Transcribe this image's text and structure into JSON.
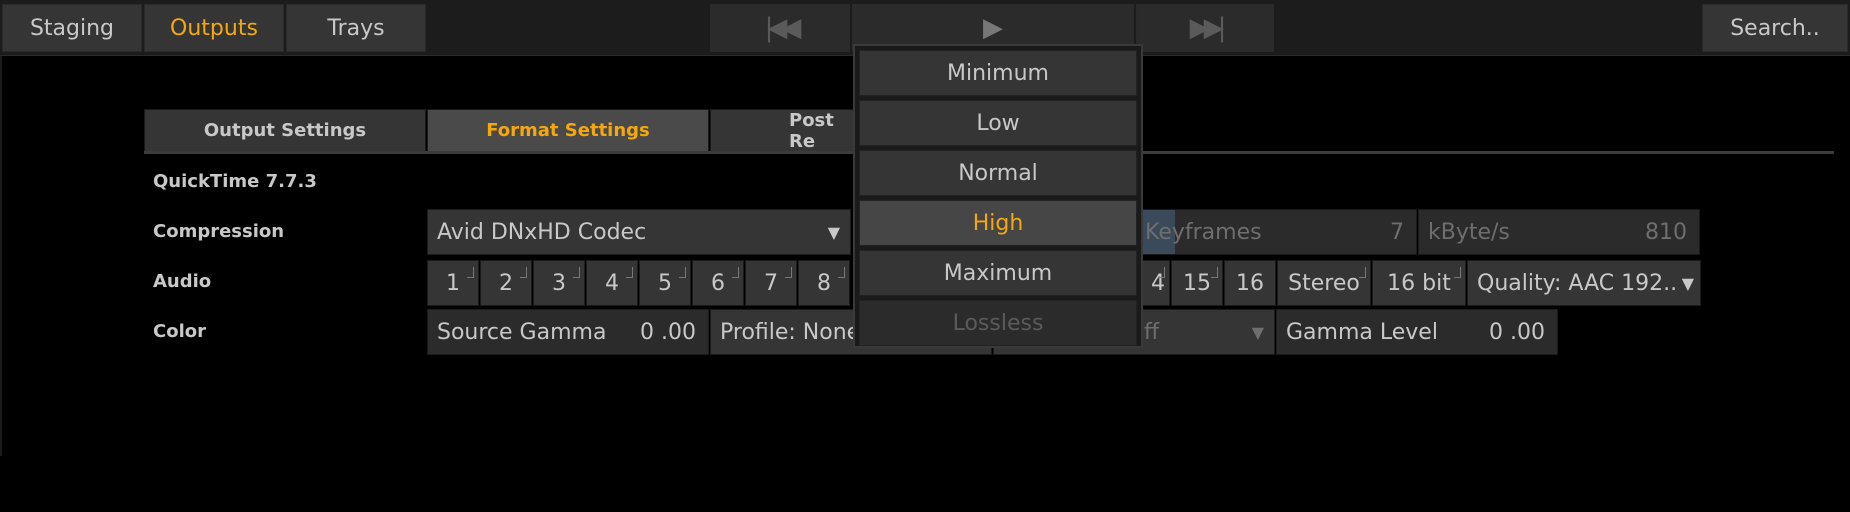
{
  "topbar": {
    "tabs": [
      "Staging",
      "Outputs",
      "Trays"
    ],
    "active_tab": "Outputs",
    "search_label": "Search.."
  },
  "subtabs": {
    "output_settings": "Output Settings",
    "format_settings": "Format Settings",
    "post_render": "Post Re"
  },
  "format_label": "QuickTime 7.7.3",
  "rows": {
    "compression": "Compression",
    "audio": "Audio",
    "color": "Color"
  },
  "compression": {
    "codec": "Avid DNxHD Codec",
    "keyframes_label": "Keyframes",
    "keyframes_value": "7",
    "kbyte_label": "kByte/s",
    "kbyte_value": "810"
  },
  "audio": {
    "channels_left": [
      "1",
      "2",
      "3",
      "4",
      "5",
      "6",
      "7",
      "8"
    ],
    "channels_right": [
      "4",
      "15",
      "16"
    ],
    "stereo": "Stereo",
    "bit_depth": "16 bit",
    "quality": "Quality: AAC 192.."
  },
  "color": {
    "source_gamma_label": "Source Gamma",
    "source_gamma_value": "0 .00",
    "profile": "Profile: None",
    "off_fragment": "ff",
    "gamma_level_label": "Gamma Level",
    "gamma_level_value": "0 .00"
  },
  "quality_dropdown": {
    "options": [
      "Minimum",
      "Low",
      "Normal",
      "High",
      "Maximum",
      "Lossless"
    ],
    "selected": "High",
    "disabled": "Lossless"
  },
  "colors": {
    "accent": "#f5a80e",
    "panel": "#353535",
    "background": "#000000"
  }
}
